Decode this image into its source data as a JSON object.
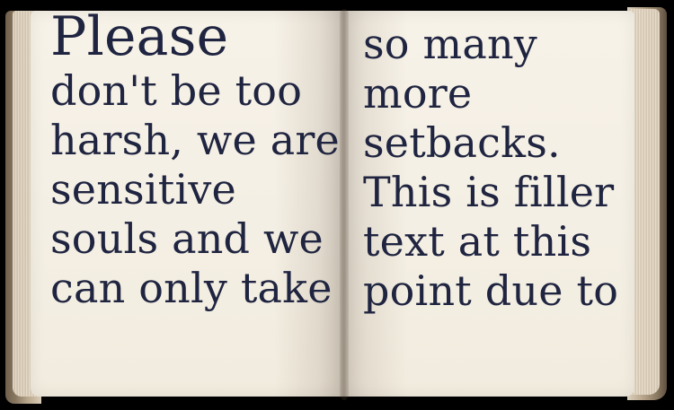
{
  "book": {
    "left_page": {
      "lines": [
        "Please",
        "don't be too",
        "harsh, we are",
        "sensitive",
        "souls and we",
        "can only take"
      ]
    },
    "right_page": {
      "lines": [
        "so many",
        "more",
        "setbacks.",
        "This is filler",
        "text at this",
        "point due to"
      ]
    }
  }
}
